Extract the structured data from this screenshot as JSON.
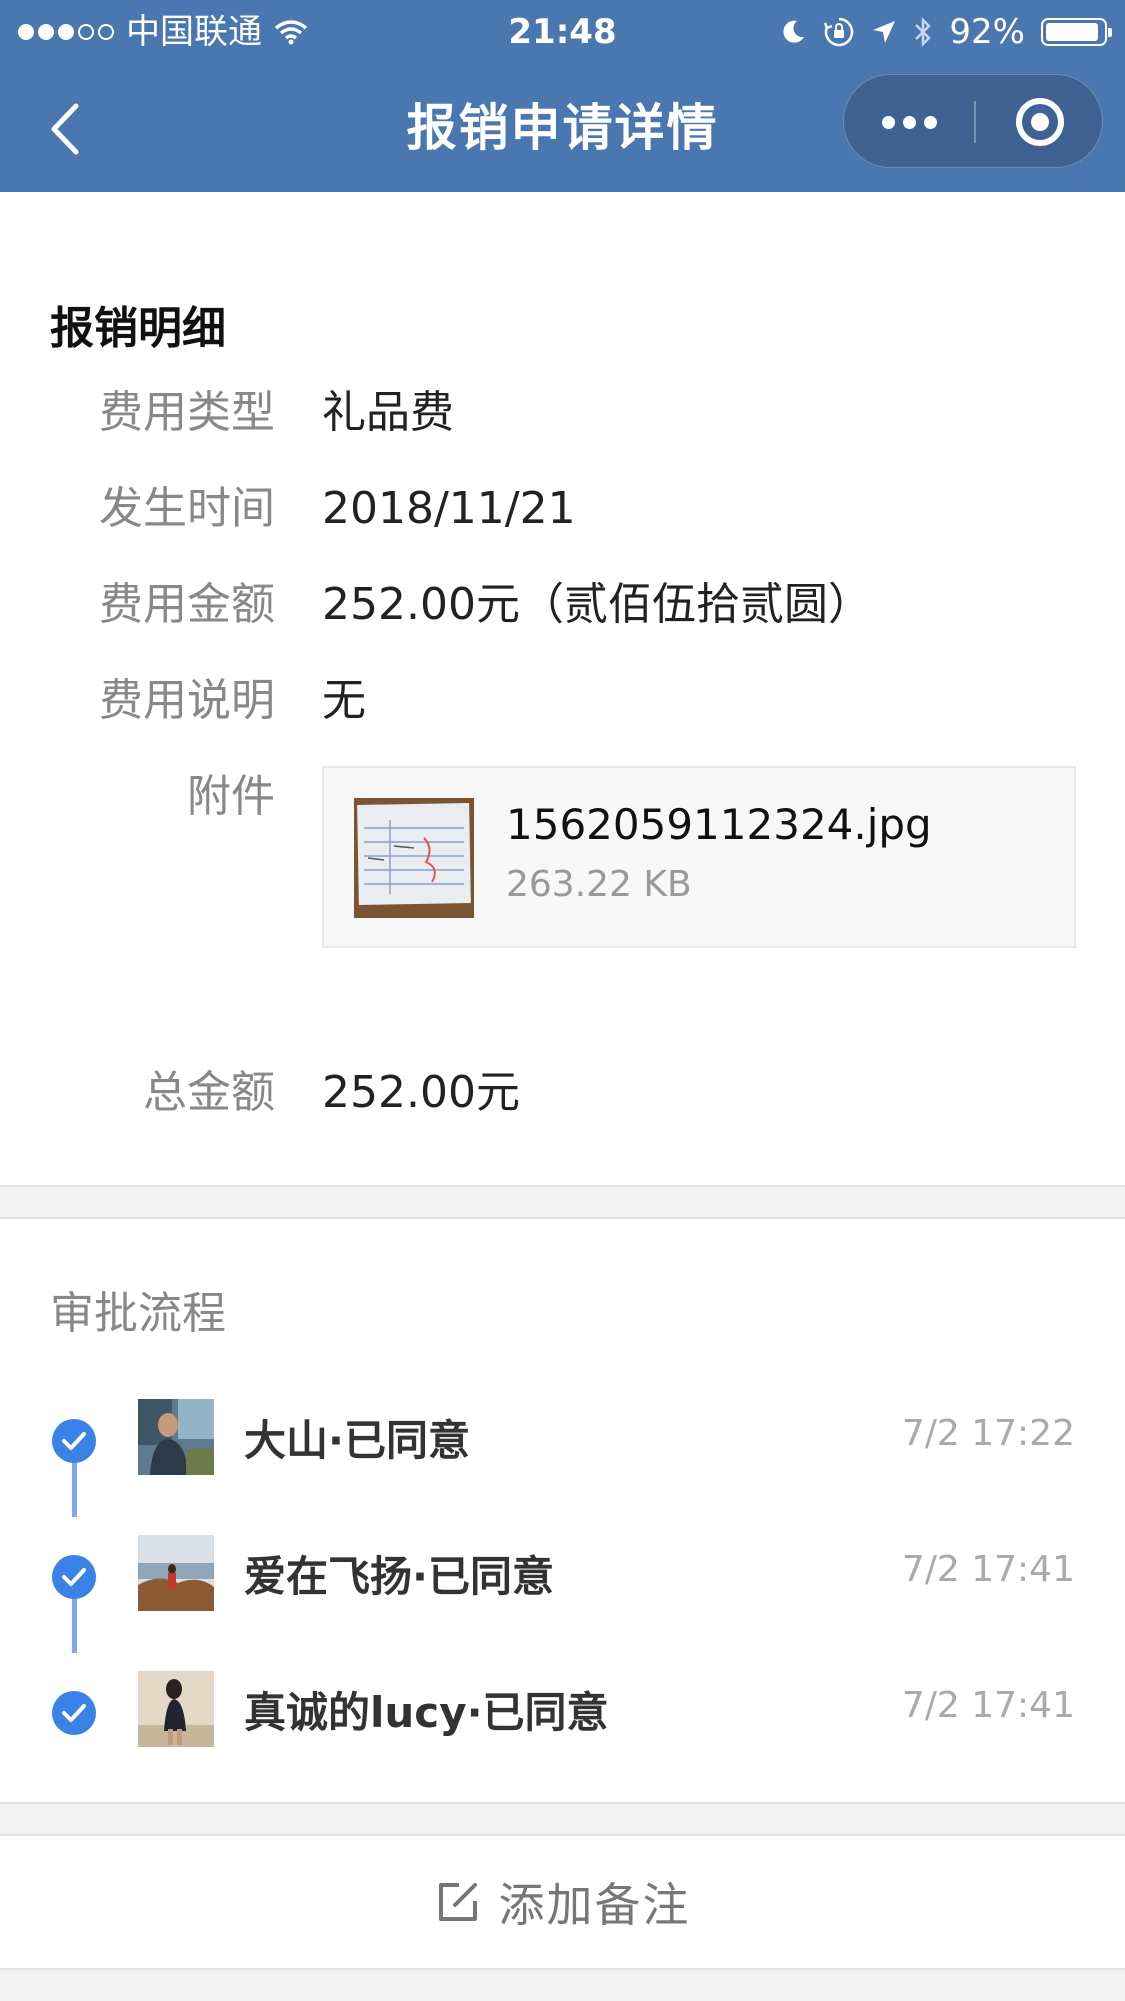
{
  "status_bar": {
    "carrier": "中国联通",
    "time": "21:48",
    "battery_text": "92%",
    "battery_level": 0.92
  },
  "nav": {
    "title": "报销申请详情",
    "icons": [
      "chevron-left-icon",
      "more-dots-icon",
      "capsule-close-icon"
    ]
  },
  "detail": {
    "section_title": "报销明细",
    "fields": [
      {
        "label": "费用类型",
        "value": "礼品费"
      },
      {
        "label": "发生时间",
        "value": "2018/11/21"
      },
      {
        "label": "费用金额",
        "value": "252.00元（贰佰伍拾贰圆）"
      },
      {
        "label": "费用说明",
        "value": "无"
      }
    ],
    "attachment_label": "附件",
    "attachment": {
      "file_name": "1562059112324.jpg",
      "file_size": "263.22 KB"
    },
    "total_label": "总金额",
    "total_value": "252.00元"
  },
  "approval": {
    "title": "审批流程",
    "steps": [
      {
        "name": "大山·已同意",
        "time": "7/2 17:22"
      },
      {
        "name": "爱在飞扬·已同意",
        "time": "7/2 17:41"
      },
      {
        "name": "真诚的lucy·已同意",
        "time": "7/2 17:41"
      }
    ]
  },
  "footer": {
    "add_note_label": "添加备注"
  },
  "colors": {
    "nav_bg": "#4a77b0",
    "check_blue": "#3b82e6",
    "timeline": "#7ea8ef"
  }
}
